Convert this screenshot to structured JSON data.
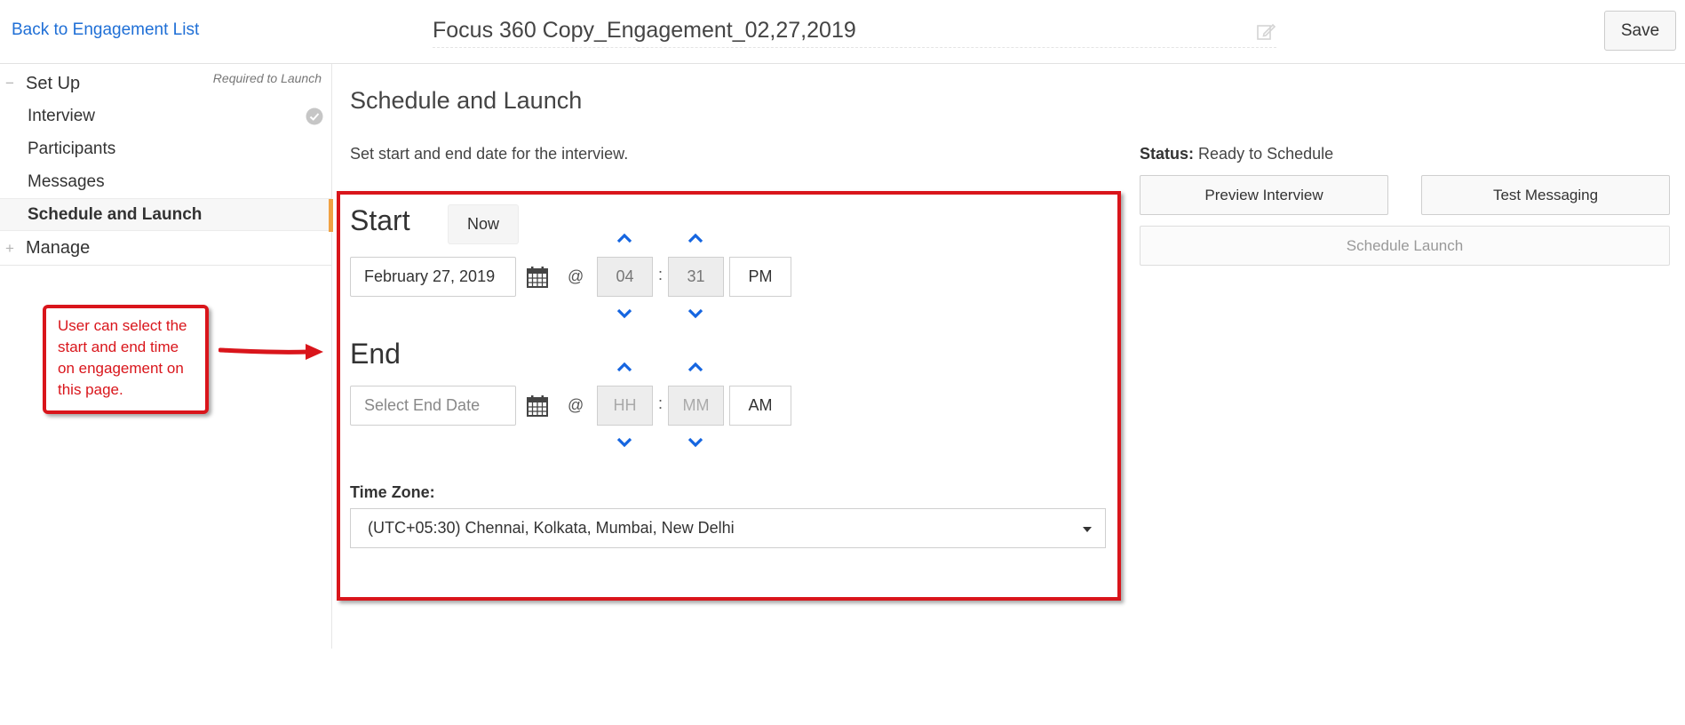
{
  "header": {
    "back_link": "Back to Engagement List",
    "title": "Focus 360 Copy_Engagement_02,27,2019",
    "save_label": "Save"
  },
  "sidebar": {
    "setup": {
      "toggle": "−",
      "label": "Set Up",
      "note": "Required to Launch"
    },
    "items": [
      {
        "label": "Interview",
        "completed": true
      },
      {
        "label": "Participants"
      },
      {
        "label": "Messages"
      },
      {
        "label": "Schedule and Launch",
        "active": true
      }
    ],
    "manage": {
      "toggle": "+",
      "label": "Manage"
    }
  },
  "annotation": {
    "text": "User can select the start and end time on engagement on this page.",
    "color": "#d9151b"
  },
  "main": {
    "title": "Schedule and Launch",
    "description": "Set start and end date for the interview.",
    "start": {
      "label": "Start",
      "now_label": "Now",
      "date_value": "February 27, 2019",
      "at": "@",
      "hour": "04",
      "colon": ":",
      "minute": "31",
      "ampm": "PM"
    },
    "end": {
      "label": "End",
      "date_placeholder": "Select End Date",
      "at": "@",
      "hour_placeholder": "HH",
      "colon": ":",
      "minute_placeholder": "MM",
      "ampm": "AM"
    },
    "timezone": {
      "label": "Time Zone:",
      "selected": "(UTC+05:30) Chennai, Kolkata, Mumbai, New Delhi"
    }
  },
  "panel": {
    "status_label": "Status:",
    "status_value": "Ready to Schedule",
    "preview_label": "Preview Interview",
    "test_label": "Test Messaging",
    "schedule_label": "Schedule Launch"
  },
  "colors": {
    "link": "#1f6fd6",
    "active_accent": "#f0a244",
    "chevron": "#1565e0",
    "highlight": "#d9151b"
  }
}
